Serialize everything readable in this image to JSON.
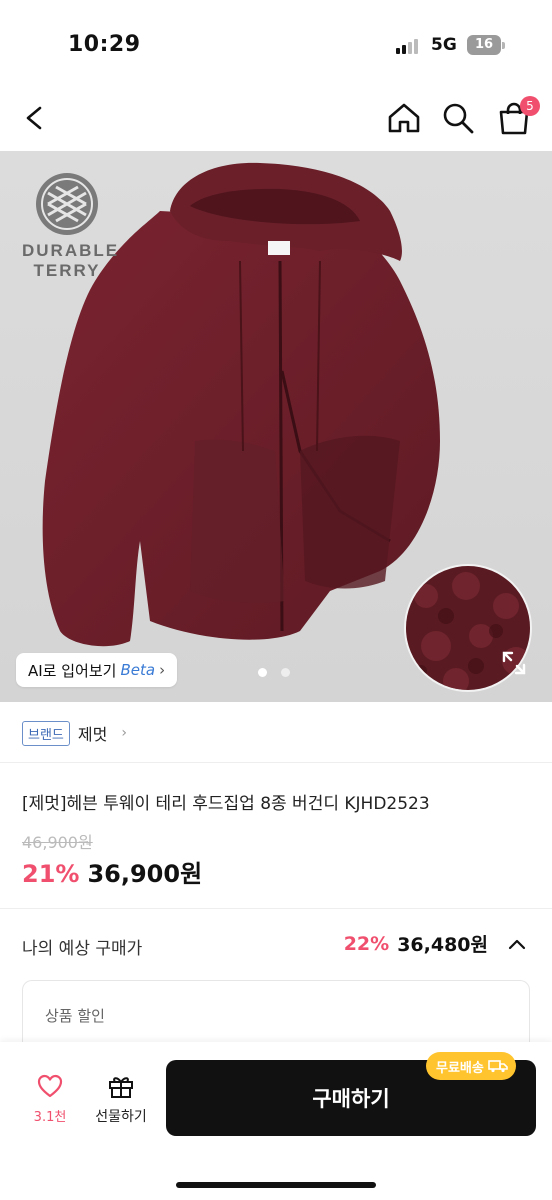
{
  "status": {
    "time": "10:29",
    "network": "5G",
    "battery": "16"
  },
  "header": {
    "cart_count": "5"
  },
  "hero": {
    "brand_logo_line1": "DURABLE",
    "brand_logo_line2": "TERRY",
    "ai_button_label": "AI로 입어보기",
    "ai_beta": "Beta",
    "page_dots": 2,
    "active_dot": 1
  },
  "brand": {
    "tag": "브랜드",
    "name": "제멋"
  },
  "product": {
    "title": "[제멋]헤븐 투웨이 테리 후드집업 8종 버건디 KJHD2523",
    "original_price": "46,900원",
    "discount_rate": "21%",
    "price": "36,900원"
  },
  "estimate": {
    "label": "나의 예상 구매가",
    "discount_rate": "22%",
    "price": "36,480원",
    "discount_section_label": "상품 할인"
  },
  "bottom": {
    "like_count": "3.1천",
    "gift_label": "선물하기",
    "buy_label": "구매하기",
    "free_shipping_label": "무료배송"
  },
  "colors": {
    "accent": "#f0506e",
    "burgundy": "#6e1f2a",
    "free_ship": "#ffc42e"
  }
}
